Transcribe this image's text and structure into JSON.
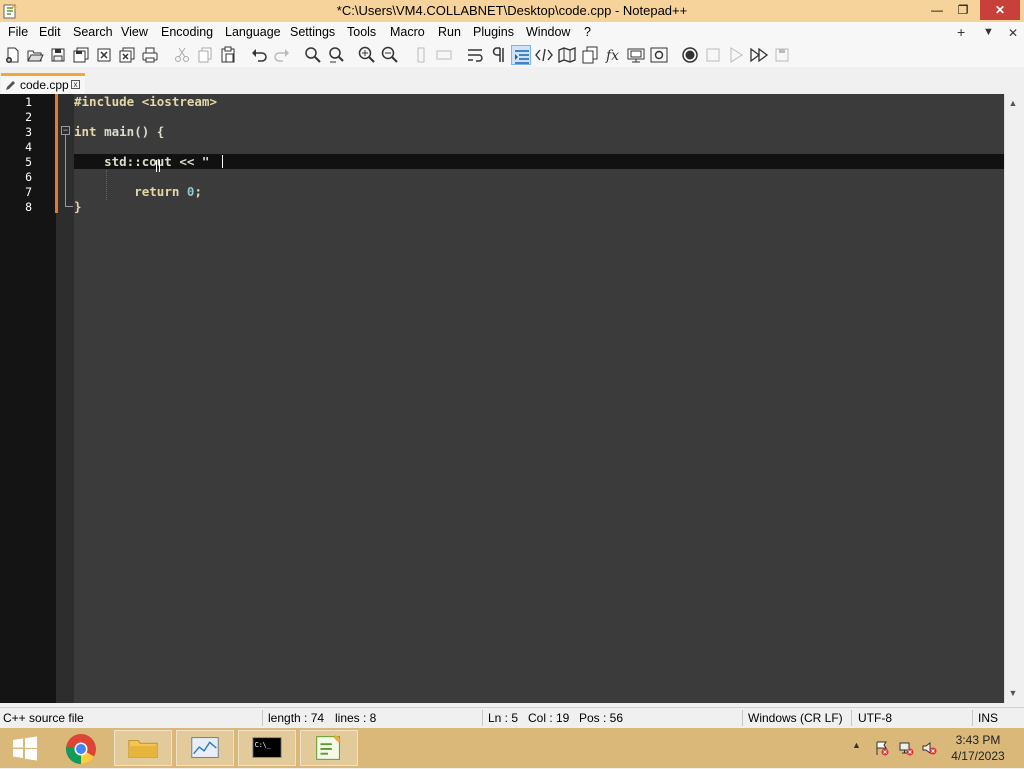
{
  "window": {
    "title": "*C:\\Users\\VM4.COLLABNET\\Desktop\\code.cpp - Notepad++",
    "minimize_glyph": "—",
    "restore_glyph": "❐",
    "close_glyph": "✕"
  },
  "menu": {
    "items": [
      "File",
      "Edit",
      "Search",
      "View",
      "Encoding",
      "Language",
      "Settings",
      "Tools",
      "Macro",
      "Run",
      "Plugins",
      "Window",
      "?"
    ],
    "right": {
      "add": "+",
      "dropdown": "▼",
      "close": "✕"
    }
  },
  "toolbar": {
    "buttons": [
      "new-file-icon",
      "open-file-icon",
      "save-icon",
      "save-all-icon",
      "close-icon",
      "close-all-icon",
      "print-icon",
      "cut-icon",
      "copy-icon",
      "paste-icon",
      "undo-icon",
      "redo-icon",
      "find-icon",
      "replace-icon",
      "zoom-in-icon",
      "zoom-out-icon",
      "sync-vertical-icon",
      "sync-horizontal-icon",
      "word-wrap-icon",
      "show-all-characters-icon",
      "indent-guide-icon",
      "xml-tag-icon",
      "document-map-icon",
      "document-list-icon",
      "function-list-icon",
      "folder-as-workspace-icon",
      "monitoring-icon",
      "record-macro-icon",
      "stop-recording-icon",
      "play-macro-icon",
      "run-macro-multiple-icon",
      "save-macro-icon"
    ]
  },
  "tab": {
    "label": "code.cpp",
    "close_glyph": "x"
  },
  "editor": {
    "line_numbers": [
      "1",
      "2",
      "3",
      "4",
      "5",
      "6",
      "7",
      "8"
    ],
    "lines": [
      {
        "text": "#include <iostream>"
      },
      {
        "text": ""
      },
      {
        "kw": "int",
        "rest": " main() {"
      },
      {
        "text": ""
      },
      {
        "text": "    std::cout << \""
      },
      {
        "text": ""
      },
      {
        "indent": "        ",
        "kw": "return",
        "mid": " ",
        "num": "0",
        "end": ";"
      },
      {
        "text": "}"
      }
    ],
    "current_line": 5
  },
  "status": {
    "file_type": "C++ source file",
    "length": "length : 74",
    "lines": "lines : 8",
    "ln": "Ln : 5",
    "col": "Col : 19",
    "pos": "Pos : 56",
    "eol": "Windows (CR LF)",
    "encoding": "UTF-8",
    "mode": "INS"
  },
  "taskbar": {
    "apps": [
      "start-button",
      "chrome",
      "file-explorer",
      "task-manager",
      "command-prompt",
      "notepad-plus-plus"
    ],
    "clock_time": "3:43 PM",
    "clock_date": "4/17/2023"
  },
  "colors": {
    "title_bar": "#f6d39a",
    "editor_bg": "#3b3b3b",
    "gutter_bg": "#141414",
    "change_bar": "#e87a2c",
    "keyword": "#e6d7a8",
    "number": "#8acccf"
  }
}
